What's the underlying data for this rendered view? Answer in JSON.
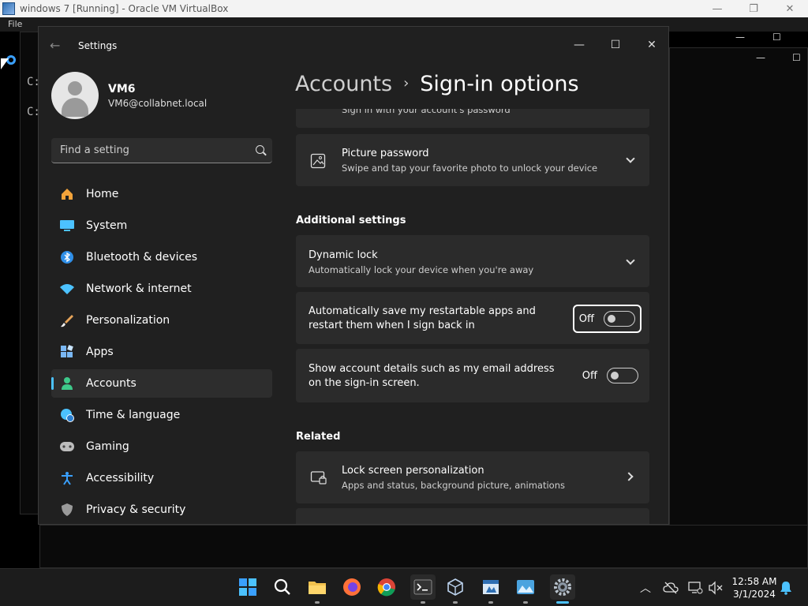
{
  "vbox": {
    "title": "windows 7 [Running] - Oracle VM VirtualBox",
    "menu_file": "File",
    "min_glyph": "—",
    "max_glyph": "❐",
    "close_glyph": "✕"
  },
  "console": {
    "line1": "C:",
    "line2": "C:"
  },
  "settings": {
    "app_title": "Settings",
    "back_glyph": "←",
    "window_min": "—",
    "window_max": "☐",
    "window_close": "✕",
    "user": {
      "name": "VM6",
      "email": "VM6@collabnet.local"
    },
    "search": {
      "placeholder": "Find a setting",
      "value": ""
    },
    "nav": [
      {
        "label": "Home",
        "icon": "home-icon",
        "color": "#f3a33a"
      },
      {
        "label": "System",
        "icon": "system-icon",
        "color": "#4cc2ff"
      },
      {
        "label": "Bluetooth & devices",
        "icon": "bluetooth-icon",
        "color": "#2f8fe8"
      },
      {
        "label": "Network & internet",
        "icon": "wifi-icon",
        "color": "#4cc2ff"
      },
      {
        "label": "Personalization",
        "icon": "brush-icon",
        "color": "#e6a45a"
      },
      {
        "label": "Apps",
        "icon": "apps-icon",
        "color": "#7ab8f5"
      },
      {
        "label": "Accounts",
        "icon": "accounts-icon",
        "color": "#3ec98a",
        "active": true
      },
      {
        "label": "Time & language",
        "icon": "globe-clock-icon",
        "color": "#4cc2ff"
      },
      {
        "label": "Gaming",
        "icon": "gamepad-icon",
        "color": "#bdbdbd"
      },
      {
        "label": "Accessibility",
        "icon": "accessibility-icon",
        "color": "#3aa0ff"
      },
      {
        "label": "Privacy & security",
        "icon": "shield-icon",
        "color": "#9a9a9a"
      }
    ],
    "breadcrumb": {
      "parent": "Accounts",
      "separator": "›",
      "current": "Sign-in options"
    },
    "cards": {
      "password_partial_sub": "Sign in with your account's password",
      "picture_password_title": "Picture password",
      "picture_password_sub": "Swipe and tap your favorite photo to unlock your device",
      "additional_header": "Additional settings",
      "dynamic_lock_title": "Dynamic lock",
      "dynamic_lock_sub": "Automatically lock your device when you're away",
      "restart_apps_title": "Automatically save my restartable apps and restart them when I sign back in",
      "restart_apps_state": "Off",
      "account_details_title": "Show account details such as my email address on the sign-in screen.",
      "account_details_state": "Off",
      "related_header": "Related",
      "lock_screen_title": "Lock screen personalization",
      "lock_screen_sub": "Apps and status, background picture, animations"
    }
  },
  "taskbar": {
    "time": "12:58 AM",
    "date": "3/1/2024",
    "accent": "#4cc2ff",
    "apps": [
      "start-icon",
      "search-icon",
      "file-explorer-icon",
      "firefox-icon",
      "chrome-icon",
      "terminal-icon",
      "virtualbox-icon",
      "snip-icon",
      "photos-icon",
      "settings-gear-icon"
    ]
  }
}
